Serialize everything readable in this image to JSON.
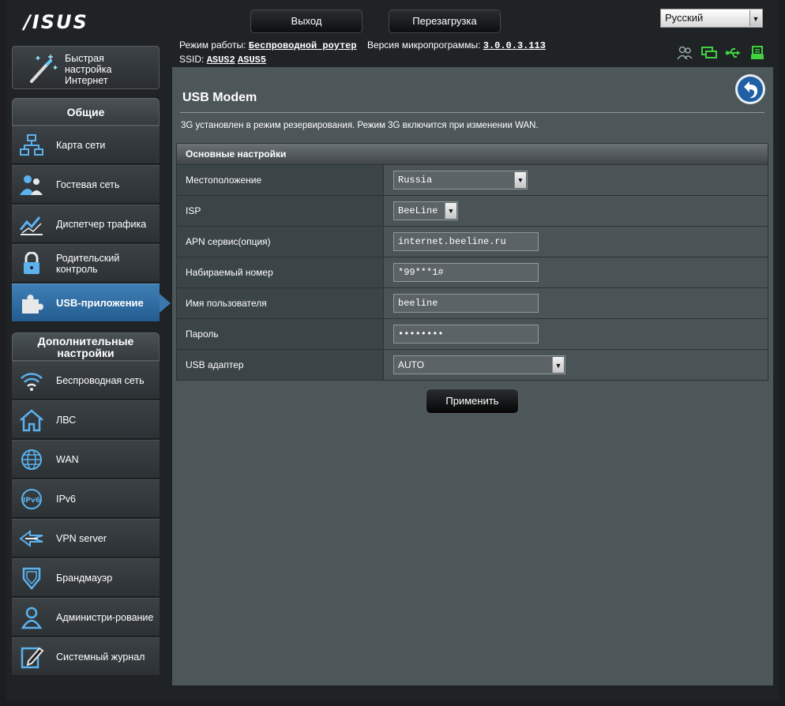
{
  "header": {
    "logo": "/ISUS",
    "logout_label": "Выход",
    "reboot_label": "Перезагрузка",
    "language": "Русский",
    "mode_label": "Режим работы:",
    "mode_value": "Беспроводной роутер",
    "firmware_label": "Версия микропрограммы:",
    "firmware_value": "3.0.0.3.113",
    "ssid_label": "SSID:",
    "ssid_1": "ASUS2",
    "ssid_2": "ASUS5",
    "status_icons": [
      "clients-icon",
      "network-status-icon",
      "usb-status-icon",
      "printer-icon"
    ],
    "status_color": "#3fd13f"
  },
  "sidebar": {
    "qis_label": "Быстрая настройка Интернет",
    "general_title": "Общие",
    "general_items": [
      {
        "label": "Карта сети",
        "icon": "network-map-icon"
      },
      {
        "label": "Гостевая сеть",
        "icon": "guest-network-icon"
      },
      {
        "label": "Диспетчер трафика",
        "icon": "traffic-manager-icon"
      },
      {
        "label": "Родительский контроль",
        "icon": "lock-icon"
      },
      {
        "label": "USB-приложение",
        "icon": "puzzle-icon",
        "active": true
      }
    ],
    "advanced_title": "Дополнительные настройки",
    "advanced_items": [
      {
        "label": "Беспроводная сеть",
        "icon": "wifi-icon"
      },
      {
        "label": "ЛВС",
        "icon": "home-icon"
      },
      {
        "label": "WAN",
        "icon": "globe-icon"
      },
      {
        "label": "IPv6",
        "icon": "ipv6-icon"
      },
      {
        "label": "VPN server",
        "icon": "vpn-icon"
      },
      {
        "label": "Брандмауэр",
        "icon": "shield-icon"
      },
      {
        "label": "Администри-рование",
        "icon": "admin-icon"
      },
      {
        "label": "Системный журнал",
        "icon": "log-icon"
      }
    ],
    "accent": "#2f6da3"
  },
  "main": {
    "title": "USB Modem",
    "description": "3G установлен в режим резервирования. Режим 3G включится при изменении WAN.",
    "section_title": "Основные настройки",
    "rows": [
      {
        "label": "Местоположение",
        "value": "Russia",
        "type": "select"
      },
      {
        "label": "ISP",
        "value": "BeeLine",
        "type": "select"
      },
      {
        "label": "APN сервис(опция)",
        "value": "internet.beeline.ru",
        "type": "input"
      },
      {
        "label": "Набираемый номер",
        "value": "*99***1#",
        "type": "input"
      },
      {
        "label": "Имя пользователя",
        "value": "beeline",
        "type": "input"
      },
      {
        "label": "Пароль",
        "value": "••••••••",
        "type": "password"
      },
      {
        "label": "USB адаптер",
        "value": "AUTO",
        "type": "select"
      }
    ],
    "apply_label": "Применить"
  }
}
